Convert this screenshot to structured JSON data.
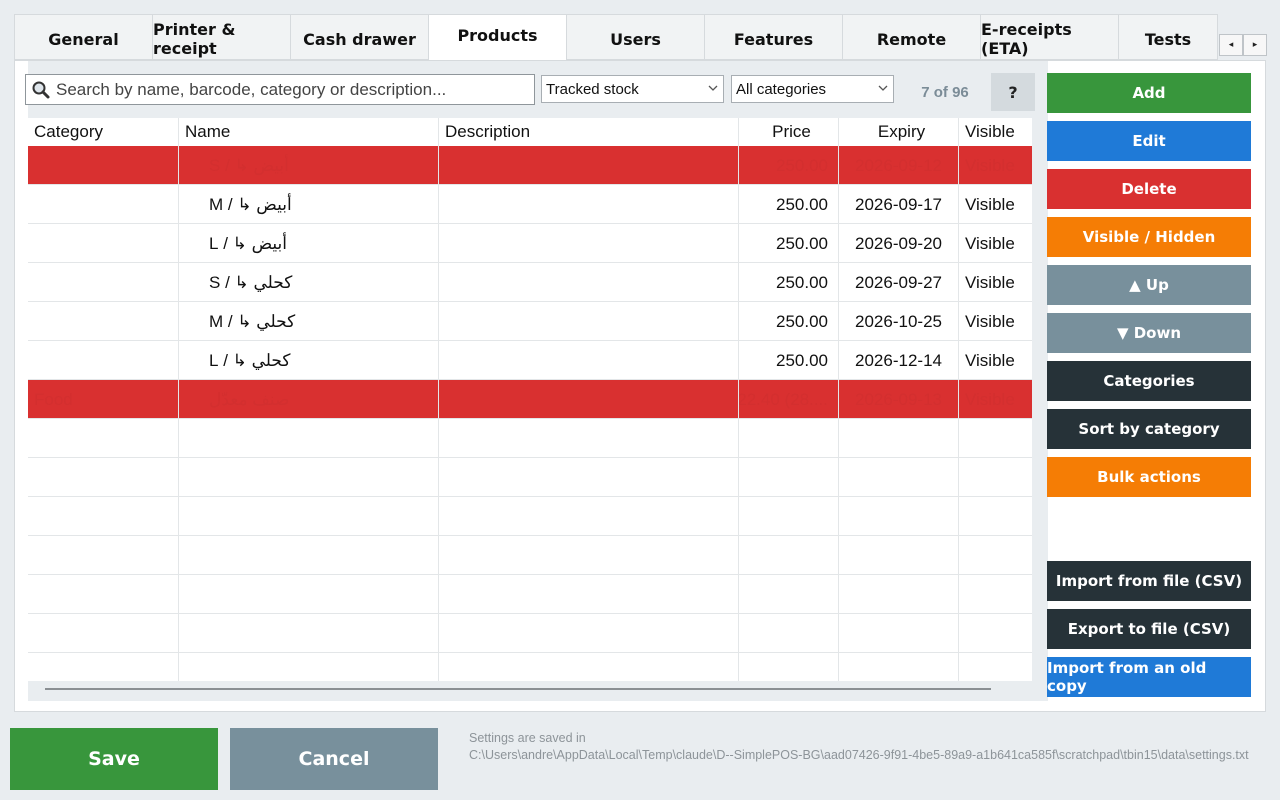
{
  "tabs": [
    "General",
    "Printer & receipt",
    "Cash drawer",
    "Products",
    "Users",
    "Features",
    "Remote",
    "E-receipts (ETA)",
    "Tests"
  ],
  "active_tab": "Products",
  "tab_scroll": {
    "left": "◂",
    "right": "▸"
  },
  "search": {
    "placeholder": "Search by name, barcode, category or description..."
  },
  "filters": {
    "stock": "Tracked stock",
    "category": "All categories"
  },
  "count": "7 of 96",
  "help_label": "?",
  "table": {
    "headers": [
      "Category",
      "Name",
      "Description",
      "Price",
      "Expiry",
      "Visible"
    ],
    "rows": [
      {
        "category": "",
        "name": "أبيض ↳ / S",
        "description": "",
        "price": "250.00",
        "expiry": "2026-09-12",
        "visible": "Visible",
        "highlight": true
      },
      {
        "category": "",
        "name": "أبيض ↳ / M",
        "description": "",
        "price": "250.00",
        "expiry": "2026-09-17",
        "visible": "Visible",
        "highlight": false
      },
      {
        "category": "",
        "name": "أبيض ↳ / L",
        "description": "",
        "price": "250.00",
        "expiry": "2026-09-20",
        "visible": "Visible",
        "highlight": false
      },
      {
        "category": "",
        "name": "كحلي ↳ / S",
        "description": "",
        "price": "250.00",
        "expiry": "2026-09-27",
        "visible": "Visible",
        "highlight": false
      },
      {
        "category": "",
        "name": "كحلي ↳ / M",
        "description": "",
        "price": "250.00",
        "expiry": "2026-10-25",
        "visible": "Visible",
        "highlight": false
      },
      {
        "category": "",
        "name": "كحلي ↳ / L",
        "description": "",
        "price": "250.00",
        "expiry": "2026-12-14",
        "visible": "Visible",
        "highlight": false
      },
      {
        "category": "Food",
        "name": "صنف معدّل",
        "description": "",
        "price": "22.40 (28....",
        "expiry": "2026-09-13",
        "visible": "Visible",
        "highlight": true
      }
    ]
  },
  "side_buttons": {
    "add": "Add",
    "edit": "Edit",
    "delete": "Delete",
    "visible_hidden": "Visible / Hidden",
    "up": "▲ Up",
    "down": "▼ Down",
    "categories": "Categories",
    "sort_by_category": "Sort by category",
    "bulk_actions": "Bulk actions",
    "import_csv": "Import from file (CSV)",
    "export_csv": "Export to file (CSV)",
    "import_old": "Import from an old copy"
  },
  "bottom": {
    "save": "Save",
    "cancel": "Cancel",
    "settings_label": "Settings are saved in",
    "settings_path": "C:\\Users\\andre\\AppData\\Local\\Temp\\claude\\D--SimplePOS-BG\\aad07426-9f91-4be5-89a9-a1b641ca585f\\scratchpad\\tbin15\\data\\settings.txt"
  },
  "colors": {
    "highlight_text": "#d32f2f",
    "green": "#38963c",
    "blue": "#1f7ad7",
    "red": "#d93030",
    "orange": "#f57d05",
    "grey": "#78909c",
    "dark": "#263238"
  }
}
